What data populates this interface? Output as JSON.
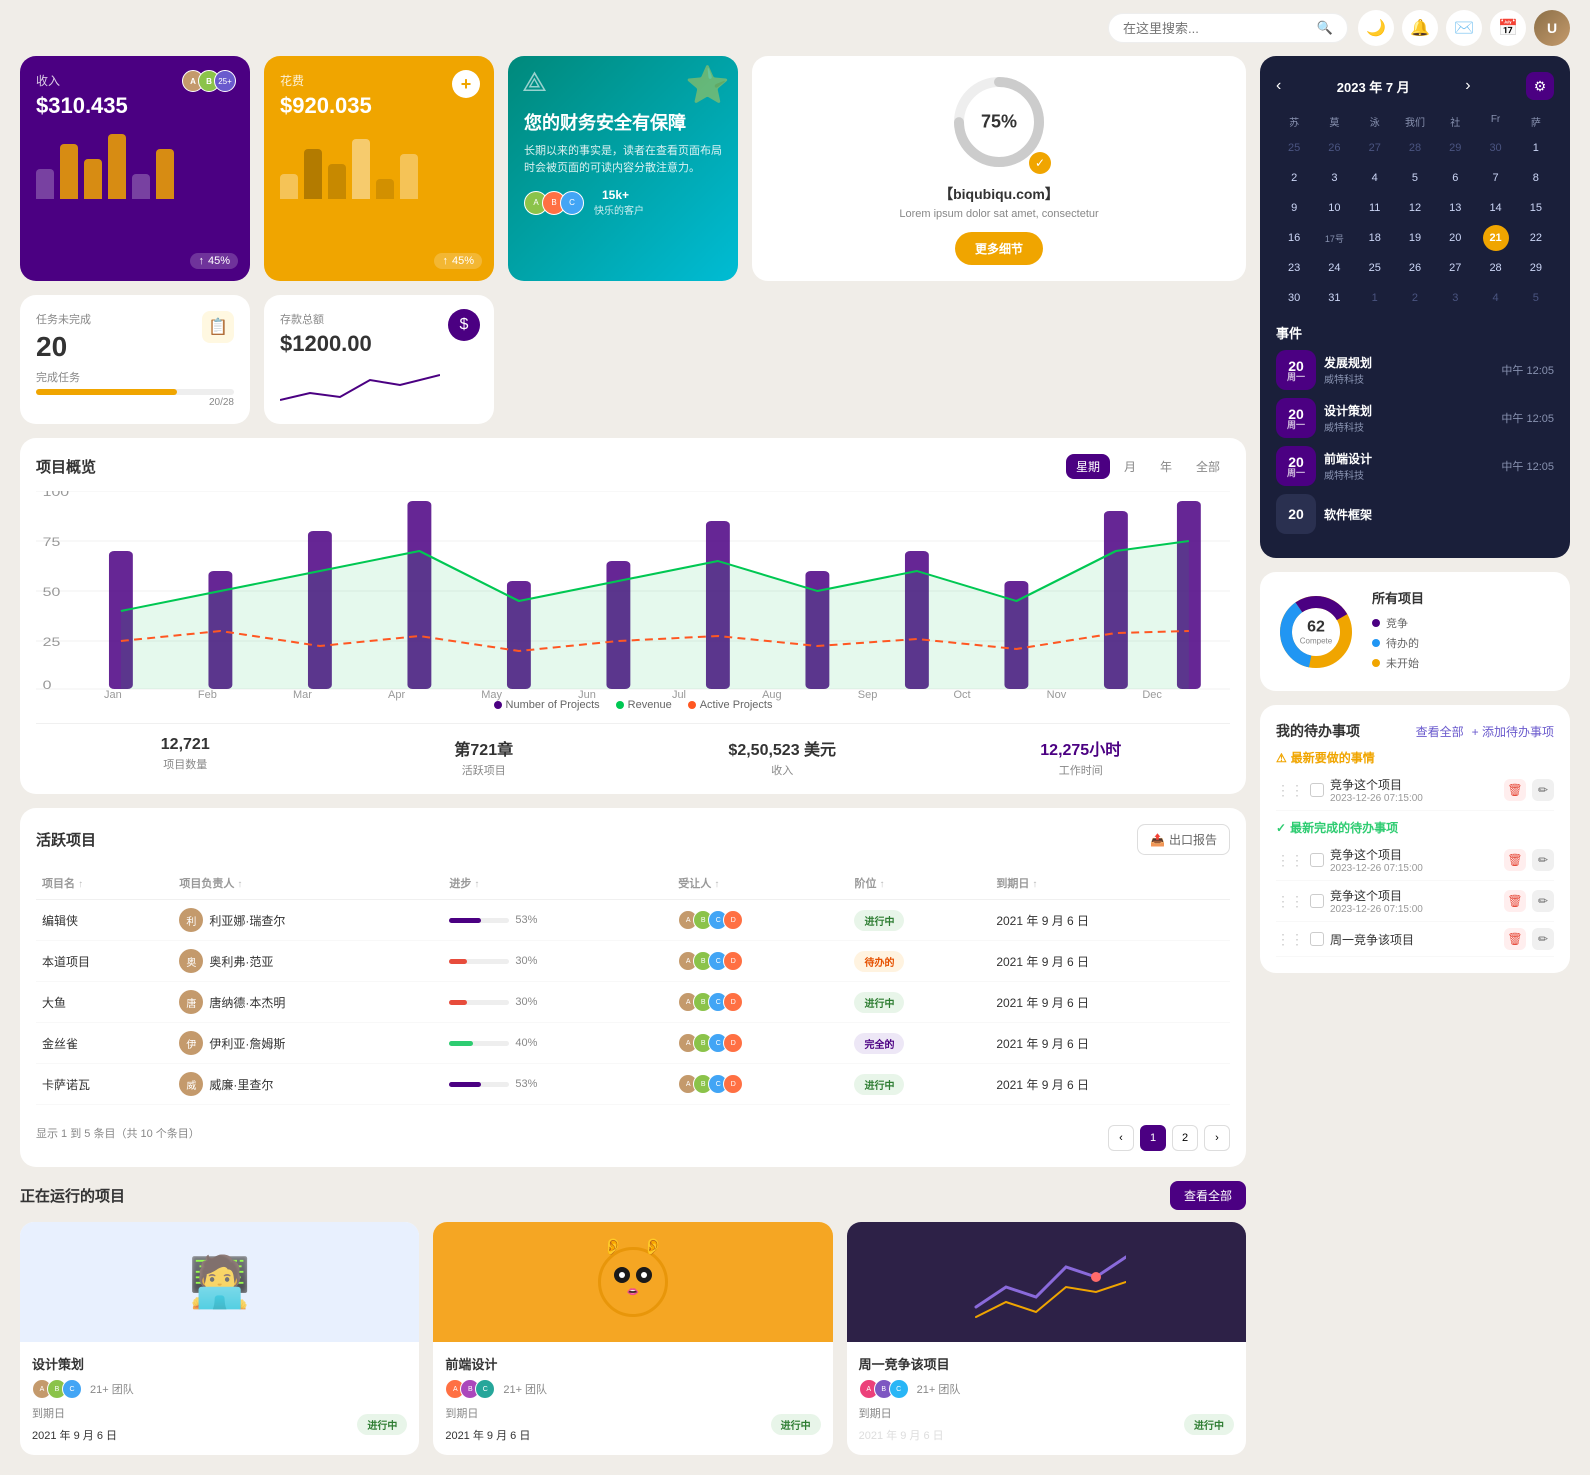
{
  "topbar": {
    "search_placeholder": "在这里搜索...",
    "icons": [
      "🌙",
      "🔔",
      "✉️",
      "📅"
    ]
  },
  "cards": {
    "revenue": {
      "label": "收入",
      "amount": "$310.435",
      "percent": "45%",
      "avatar_count": "25+"
    },
    "expense": {
      "label": "花费",
      "amount": "$920.035",
      "percent": "45%"
    },
    "promo": {
      "title": "您的财务安全有保障",
      "desc": "长期以来的事实是，读者在查看页面布局时会被页面的可读内容分散注意力。",
      "customer_count": "15k+",
      "customer_label": "快乐的客户"
    },
    "circle": {
      "percent": "75%",
      "domain": "【biqubiqu.com】",
      "sub": "Lorem ipsum dolor sat amet, consectetur",
      "btn_label": "更多细节"
    },
    "task": {
      "label": "任务未完成",
      "number": "20",
      "progress_label": "完成任务",
      "progress_value": "20/28",
      "progress_percent": 71
    },
    "savings": {
      "label": "存款总额",
      "amount": "$1200.00"
    }
  },
  "project_overview": {
    "title": "项目概览",
    "tabs": [
      "星期",
      "月",
      "年",
      "全部"
    ],
    "active_tab": 0,
    "legend": [
      {
        "label": "Number of Projects",
        "color": "#4b0082"
      },
      {
        "label": "Revenue",
        "color": "#00c853"
      },
      {
        "label": "Active Projects",
        "color": "#ff5722"
      }
    ],
    "months": [
      "Jan",
      "Feb",
      "Mar",
      "Apr",
      "May",
      "Jun",
      "Jul",
      "Aug",
      "Sep",
      "Oct",
      "Nov",
      "Dec"
    ],
    "stats": [
      {
        "value": "12,721",
        "label": "项目数量"
      },
      {
        "value": "第721章",
        "label": "活跃项目"
      },
      {
        "value": "$2,50,523 美元",
        "label": "收入"
      },
      {
        "value": "12,275小时",
        "label": "工作时间",
        "color": "purple"
      }
    ]
  },
  "active_projects": {
    "title": "活跃项目",
    "export_label": "出口报告",
    "columns": [
      "项目名 ↑",
      "项目负责人 ↑",
      "进步 ↑",
      "受让人 ↑",
      "阶位 ↑",
      "到期日 ↑"
    ],
    "rows": [
      {
        "name": "编辑侠",
        "manager": "利亚娜·瑞查尔",
        "progress": 53,
        "progress_color": "#4b0082",
        "status": "进行中",
        "status_class": "status-active",
        "due": "2021 年 9 月 6 日"
      },
      {
        "name": "本道项目",
        "manager": "奥利弗·范亚",
        "progress": 30,
        "progress_color": "#e74c3c",
        "status": "待办的",
        "status_class": "status-waiting",
        "due": "2021 年 9 月 6 日"
      },
      {
        "name": "大鱼",
        "manager": "唐纳德·本杰明",
        "progress": 30,
        "progress_color": "#e74c3c",
        "status": "进行中",
        "status_class": "status-active",
        "due": "2021 年 9 月 6 日"
      },
      {
        "name": "金丝雀",
        "manager": "伊利亚·詹姆斯",
        "progress": 40,
        "progress_color": "#2ecc71",
        "status": "完全的",
        "status_class": "status-complete",
        "due": "2021 年 9 月 6 日"
      },
      {
        "name": "卡萨诺瓦",
        "manager": "威廉·里查尔",
        "progress": 53,
        "progress_color": "#4b0082",
        "status": "进行中",
        "status_class": "status-active",
        "due": "2021 年 9 月 6 日"
      }
    ],
    "pagination": {
      "info": "显示 1 到 5 条目（共 10 个条目）",
      "current_page": 1,
      "total_pages": 2
    }
  },
  "calendar": {
    "title": "2023 年 7 月",
    "day_headers": [
      "苏",
      "莫",
      "泳",
      "我们",
      "社",
      "Fr",
      "萨"
    ],
    "weeks": [
      [
        25,
        26,
        27,
        28,
        29,
        30,
        1
      ],
      [
        2,
        3,
        4,
        5,
        6,
        7,
        8
      ],
      [
        9,
        10,
        11,
        12,
        13,
        14,
        15
      ],
      [
        16,
        "17号",
        18,
        19,
        20,
        21,
        22
      ],
      [
        23,
        24,
        25,
        26,
        27,
        28,
        29
      ],
      [
        30,
        31,
        1,
        2,
        3,
        4,
        5
      ]
    ],
    "today": 21,
    "events_title": "事件",
    "events": [
      {
        "day": "20",
        "weekday": "周一",
        "name": "发展规划",
        "sub": "威特科技",
        "time": "中午 12:05",
        "color": "#4b0082"
      },
      {
        "day": "20",
        "weekday": "周一",
        "name": "设计策划",
        "sub": "威特科技",
        "time": "中午 12:05",
        "color": "#4b0082"
      },
      {
        "day": "20",
        "weekday": "周一",
        "name": "前端设计",
        "sub": "威特科技",
        "time": "中午 12:05",
        "color": "#4b0082"
      },
      {
        "day": "20",
        "weekday": "",
        "name": "软件框架",
        "sub": "",
        "time": "",
        "color": "#2a3050"
      }
    ]
  },
  "todo": {
    "title": "我的待办事项",
    "view_all": "查看全部",
    "add": "+ 添加待办事项",
    "urgent_section": "最新要做的事情",
    "completed_section": "最新完成的待办事项",
    "items": [
      {
        "text": "竞争这个项目",
        "date": "2023-12-26 07:15:00"
      },
      {
        "text": "竞争这个项目",
        "date": "2023-12-26 07:15:00"
      },
      {
        "text": "竞争这个项目",
        "date": "2023-12-26 07:15:00"
      },
      {
        "text": "周一竞争该项目",
        "date": ""
      }
    ]
  },
  "donut": {
    "title": "所有项目",
    "total": "62",
    "sub": "Compete",
    "legend": [
      {
        "label": "竞争",
        "color": "#4b0082"
      },
      {
        "label": "待办的",
        "color": "#2196f3"
      },
      {
        "label": "未开始",
        "color": "#f0a500"
      }
    ]
  },
  "running_projects": {
    "title": "正在运行的项目",
    "view_all": "查看全部",
    "projects": [
      {
        "name": "设计策划",
        "team": "21+ 团队",
        "due_label": "到期日",
        "due": "2021 年 9 月 6 日",
        "status": "进行中",
        "status_class": "status-active",
        "thumb_class": "project-thumb-1"
      },
      {
        "name": "前端设计",
        "team": "21+ 团队",
        "due_label": "到期日",
        "due": "2021 年 9 月 6 日",
        "status": "进行中",
        "status_class": "status-active",
        "thumb_class": "project-thumb-2"
      },
      {
        "name": "周一竞争该项目",
        "team": "21+ 团队",
        "due_label": "到期日",
        "due": "2021 年 9 月 6 日",
        "status": "进行中",
        "status_class": "status-active",
        "thumb_class": "project-thumb-3"
      }
    ]
  }
}
